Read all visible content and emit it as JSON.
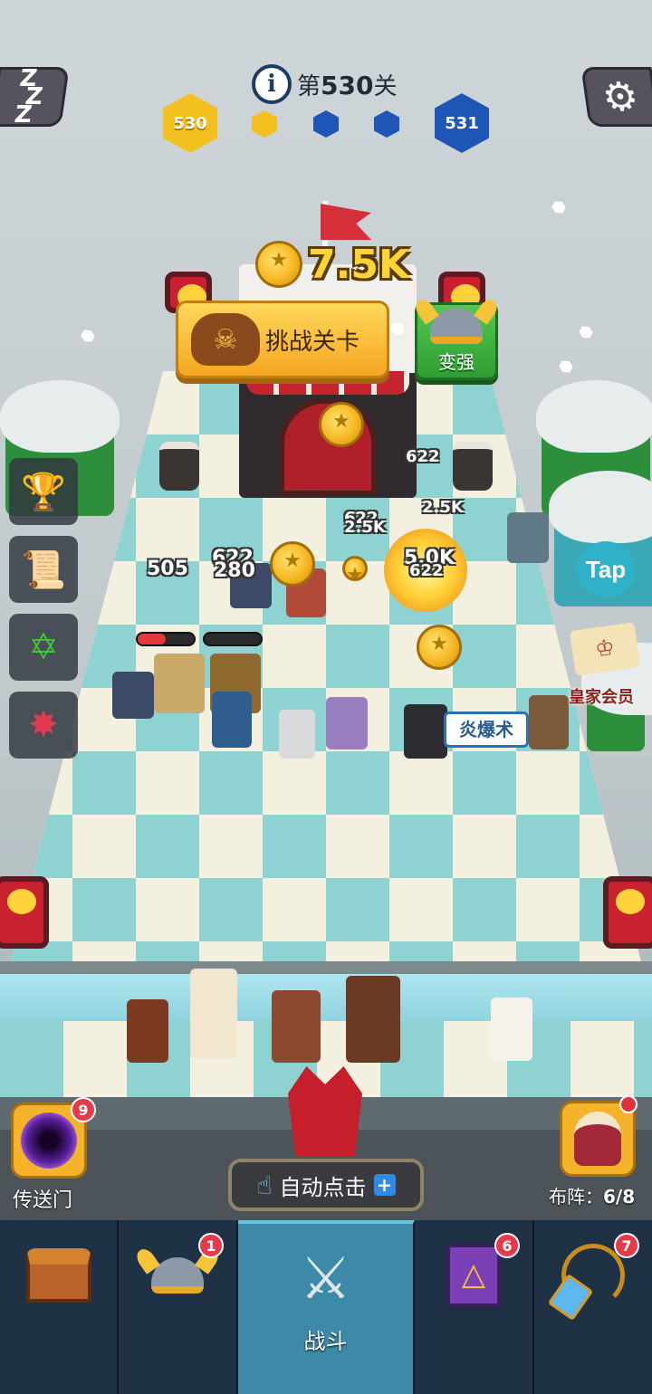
{
  "hud": {
    "level_prefix": "第",
    "level_number": "530",
    "level_suffix": "关",
    "current_level_badge": "530",
    "next_level_badge": "531",
    "stage_pips": [
      "gold",
      "blue",
      "blue"
    ]
  },
  "reward": {
    "amount": "7.5K"
  },
  "challenge_button": {
    "label": "挑战关卡"
  },
  "upgrade_button": {
    "label": "变强"
  },
  "side_menu": [
    "podium",
    "scroll",
    "star",
    "claw"
  ],
  "right_panel": {
    "tap_label": "Tap",
    "vip_label": "皇家会员"
  },
  "battle": {
    "damage_numbers": [
      "505",
      "622",
      "280",
      "622",
      "2.5K",
      "622",
      "2.5K",
      "5.0K",
      "622"
    ],
    "spell_label": "炎爆术"
  },
  "portal": {
    "label": "传送门",
    "badge": "9"
  },
  "auto_tap": {
    "label": "自动点击"
  },
  "formation": {
    "label_prefix": "布阵：",
    "value": "6/8"
  },
  "nav": {
    "tabs": [
      {
        "id": "chest",
        "label": "",
        "badge": ""
      },
      {
        "id": "heroes",
        "label": "",
        "badge": "1"
      },
      {
        "id": "battle",
        "label": "战斗",
        "badge": ""
      },
      {
        "id": "spellbook",
        "label": "",
        "badge": "6"
      },
      {
        "id": "artifact",
        "label": "",
        "badge": "7"
      }
    ]
  },
  "colors": {
    "accent_gold": "#f4c01f",
    "accent_blue": "#1e56b8",
    "nav_active": "#3d8aa8"
  }
}
